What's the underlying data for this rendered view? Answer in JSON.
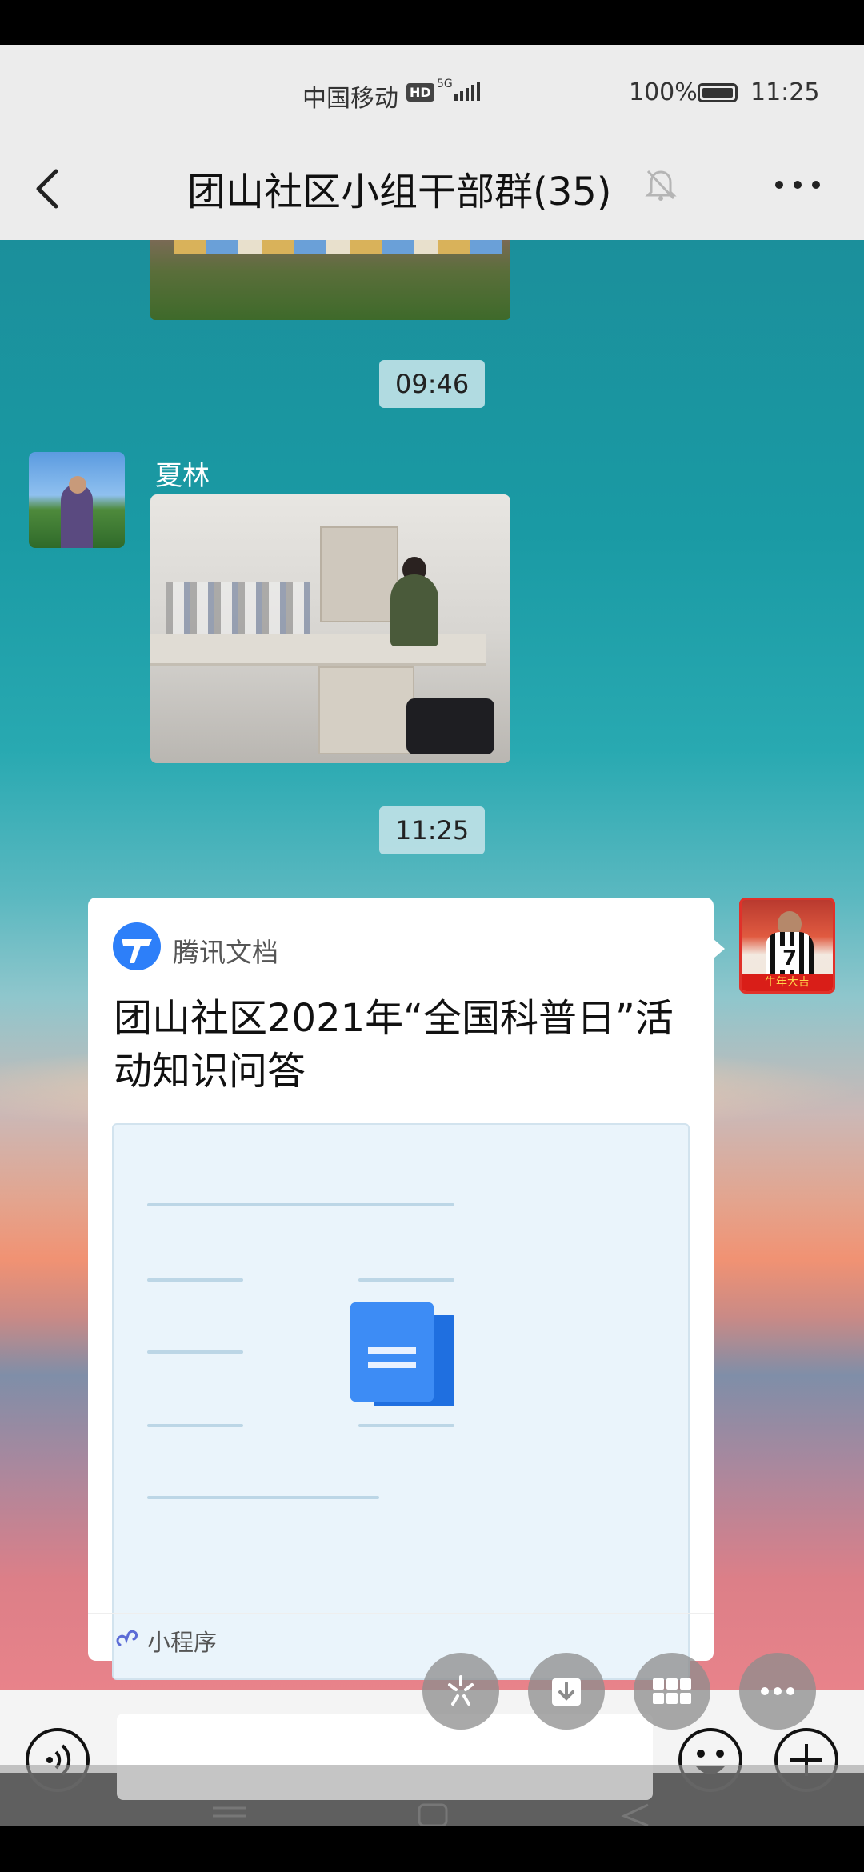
{
  "status_bar": {
    "carrier": "中国移动",
    "hd_badge": "HD",
    "network": "5G",
    "battery": "100%",
    "time": "11:25"
  },
  "header": {
    "title": "团山社区小组干部群(35)"
  },
  "messages": {
    "time_1": "09:46",
    "sender_1": "夏林",
    "time_2": "11:25"
  },
  "self_avatar": {
    "jersey_number": "7",
    "banner_text": "牛年大吉"
  },
  "card": {
    "brand": "腾讯文档",
    "title": "团山社区2021年“全国科普日”活动知识问答",
    "footer_label": "小程序"
  },
  "input": {
    "placeholder": ""
  },
  "colors": {
    "status_bg": "#ececec",
    "time_chip_bg": "#bee1e6",
    "tencent_docs_blue": "#2d7ff9",
    "fab_bg": "#8c8c8c"
  },
  "icons": [
    "back-icon",
    "mute-bell-icon",
    "more-icon",
    "tencent-docs-icon",
    "doc-icon",
    "mini-program-icon",
    "sparkle-icon",
    "download-icon",
    "grid-icon",
    "ellipsis-icon",
    "voice-icon",
    "emoji-icon",
    "plus-icon"
  ]
}
